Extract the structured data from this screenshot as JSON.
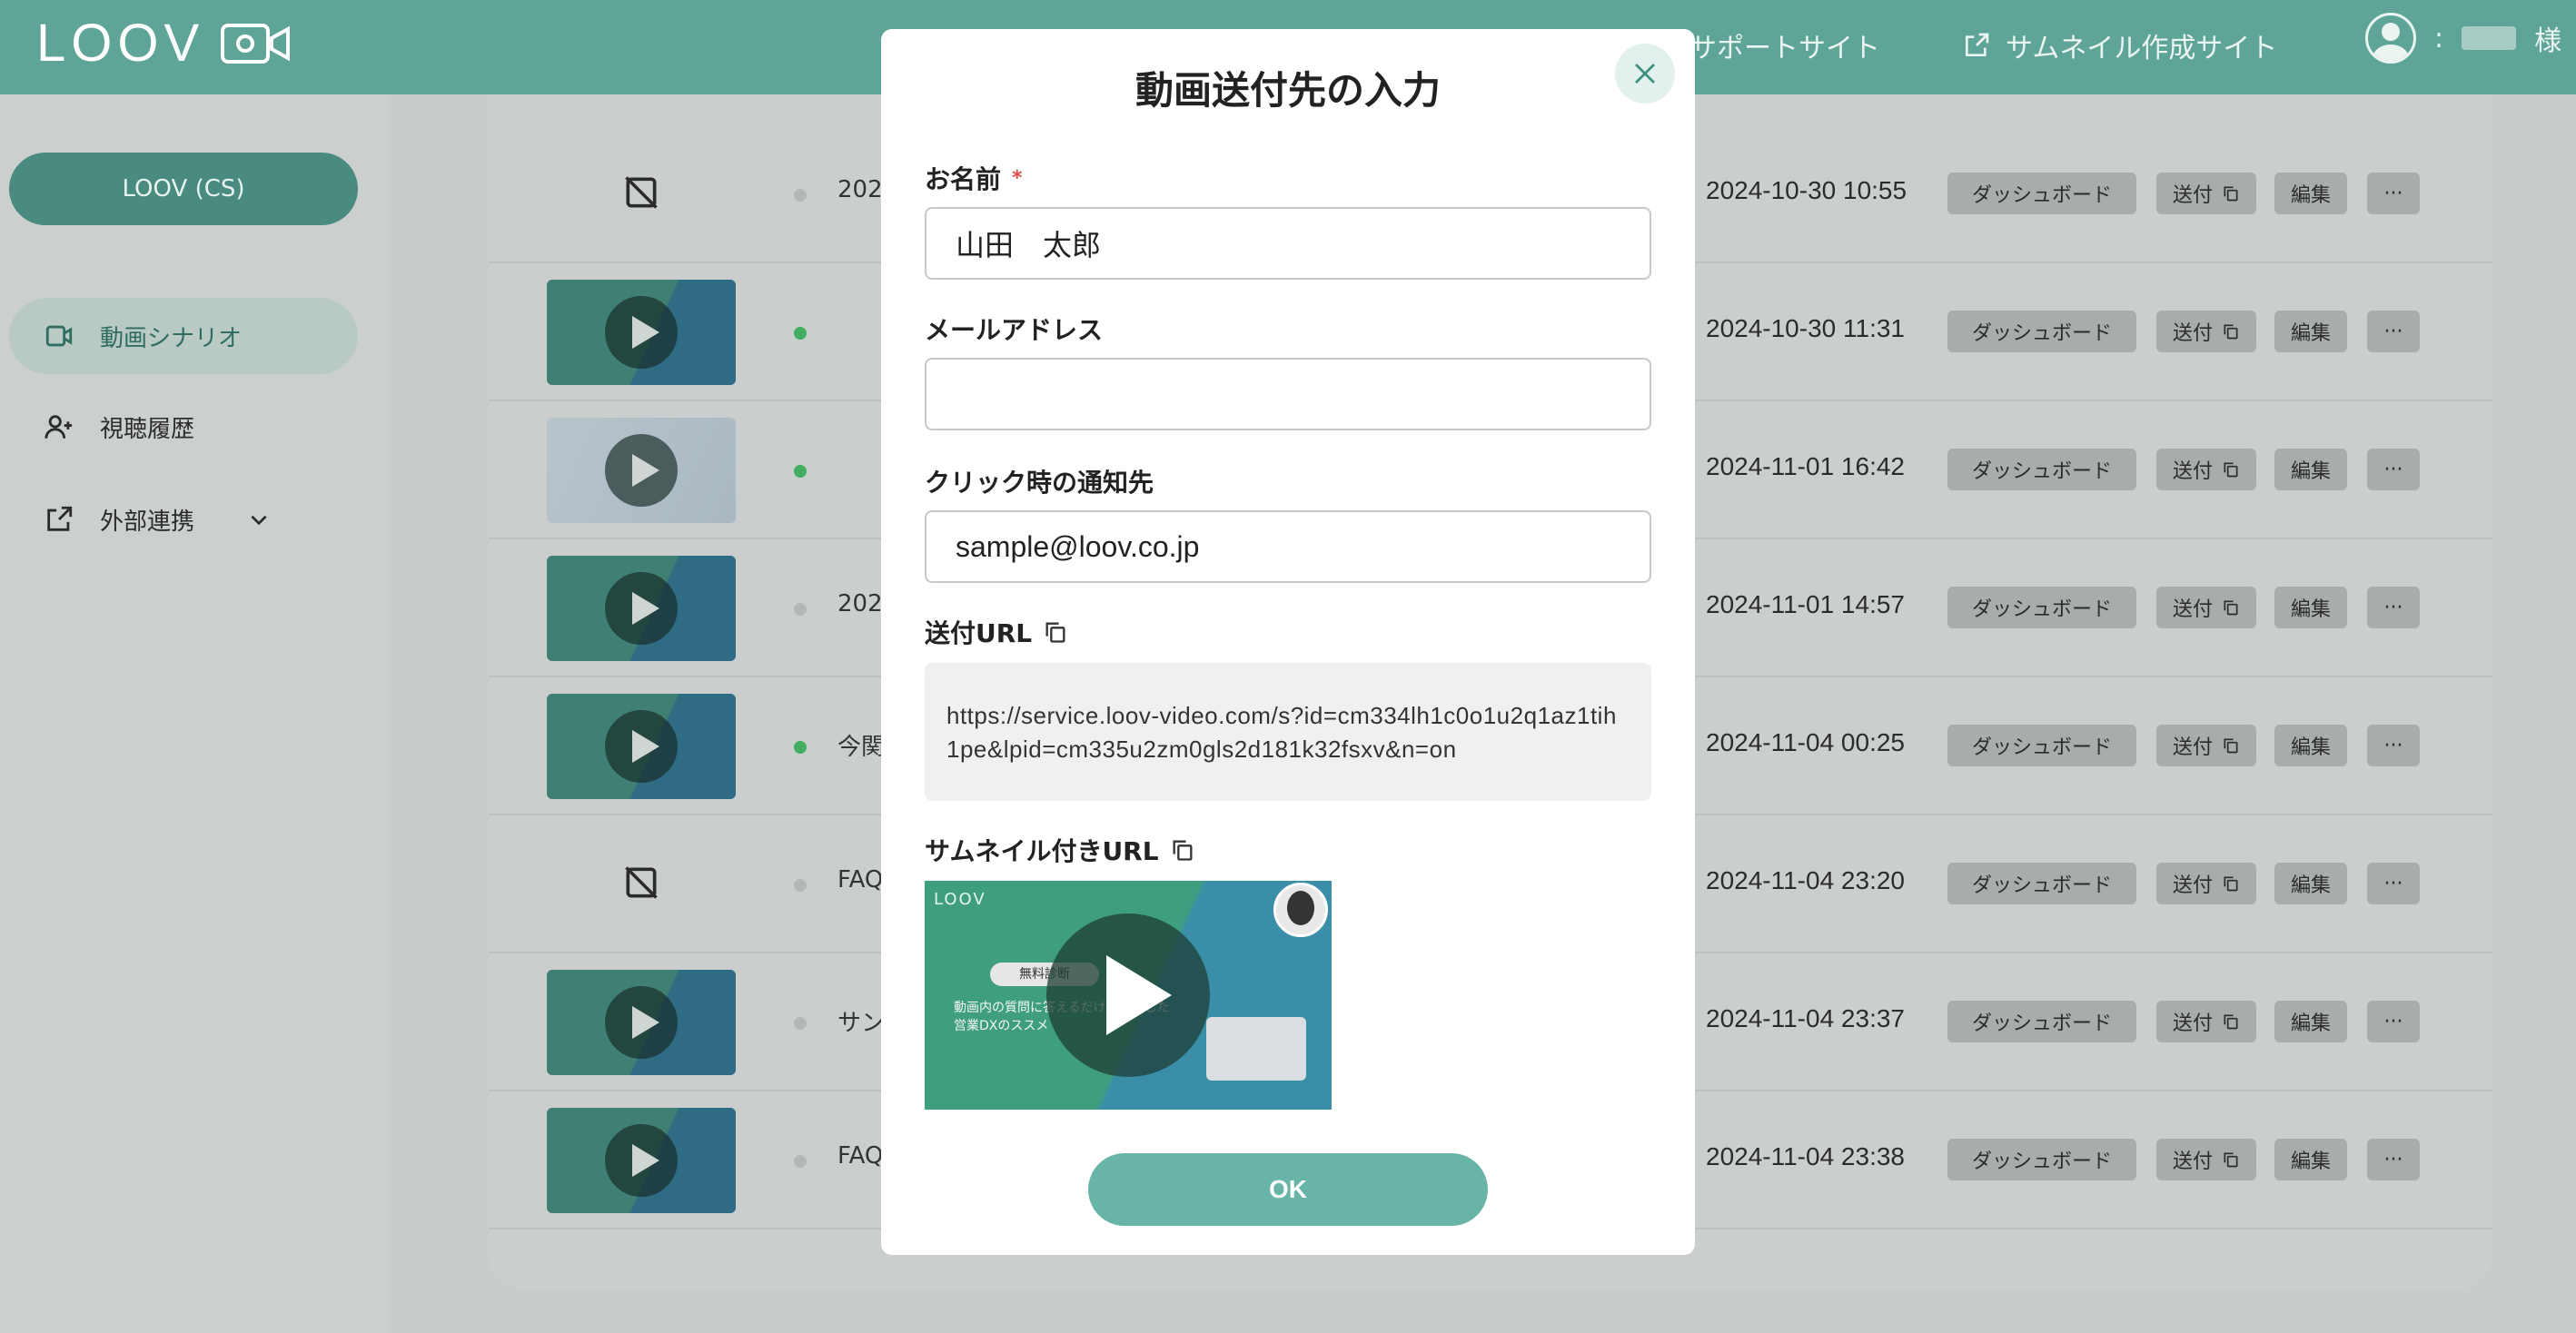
{
  "header": {
    "logo": "LOOV",
    "support_link": "サポートサイト",
    "thumbnail_link": "サムネイル作成サイト",
    "user_prefix": ":",
    "user_suffix": "様"
  },
  "sidebar": {
    "team_button": "LOOV (CS)",
    "items": [
      {
        "label": "動画シナリオ"
      },
      {
        "label": "視聴履歴"
      },
      {
        "label": "外部連携"
      }
    ]
  },
  "list": {
    "rows": [
      {
        "title": "202",
        "date": "2024-10-30 10:55",
        "status": "gray",
        "thumb": "none"
      },
      {
        "title": "",
        "date": "2024-10-30 11:31",
        "status": "green",
        "thumb": "video"
      },
      {
        "title": "",
        "date": "2024-11-01 16:42",
        "status": "green",
        "thumb": "light"
      },
      {
        "title": "202",
        "date": "2024-11-01 14:57",
        "status": "gray",
        "thumb": "video"
      },
      {
        "title": "今関",
        "date": "2024-11-04 00:25",
        "status": "green",
        "thumb": "video"
      },
      {
        "title": "FAQ",
        "date": "2024-11-04 23:20",
        "status": "gray",
        "thumb": "none"
      },
      {
        "title": "サン画」",
        "date": "2024-11-04 23:37",
        "status": "gray",
        "thumb": "video"
      },
      {
        "title": "FAQ",
        "date": "2024-11-04 23:38",
        "status": "gray",
        "thumb": "video"
      }
    ],
    "dashboard_label": "ダッシュボード",
    "send_label": "送付",
    "edit_label": "編集",
    "more_label": "···"
  },
  "modal": {
    "title": "動画送付先の入力",
    "name_label": "お名前",
    "required_mark": "*",
    "name_value": "山田　太郎",
    "email_label": "メールアドレス",
    "email_value": "",
    "notify_label": "クリック時の通知先",
    "notify_value": "sample@loov.co.jp",
    "url_label": "送付URL",
    "url_value": "https://service.loov-video.com/s?id=cm334lh1c0o1u2q1az1tih1pe&lpid=cm335u2zm0gls2d181k32fsxv&n=on",
    "thumb_url_label": "サムネイル付きURL",
    "preview": {
      "logo": "LOOV",
      "tag": "無料診断",
      "text": "動画内の質問に答えるだけで活用した営業DXのススメ"
    },
    "ok_label": "OK"
  }
}
